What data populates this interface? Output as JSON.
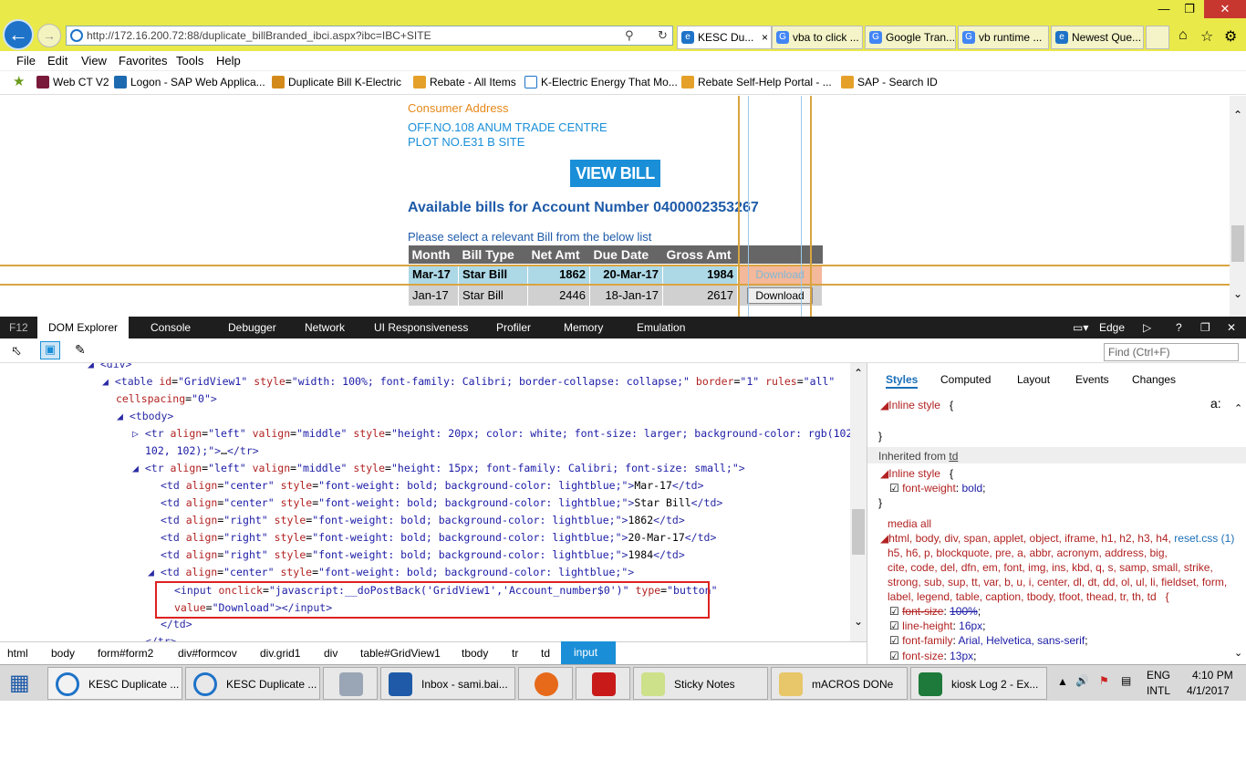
{
  "browser": {
    "address": "http://172.16.200.72:88/duplicate_billBranded_ibci.aspx?ibc=IBC+SITE",
    "tabs": [
      "KESC Du...",
      "vba to click ...",
      "Google Tran...",
      "vb runtime ...",
      "Newest Que..."
    ],
    "menu": [
      "File",
      "Edit",
      "View",
      "Favorites",
      "Tools",
      "Help"
    ],
    "favorites": [
      "Web CT V2",
      "Logon - SAP Web Applica...",
      "Duplicate Bill  K-Electric",
      "Rebate - All Items",
      "K-Electric Energy That Mo...",
      "Rebate Self-Help Portal - ...",
      "SAP - Search ID"
    ]
  },
  "page": {
    "consumer_label": "Consumer Address",
    "addr1": "OFF.NO.108 ANUM TRADE CENTRE",
    "addr2": "PLOT NO.E31 B SITE",
    "view_bill": "VIEW BILL",
    "available": "Available bills for Account Number 0400002353267",
    "please": "Please select a relevant Bill from the below list",
    "grid_headers": [
      "Month",
      "Bill Type",
      "Net Amt",
      "Due Date",
      "Gross Amt"
    ],
    "rows": [
      {
        "month": "Mar-17",
        "type": "Star Bill",
        "net": "1862",
        "due": "20-Mar-17",
        "gross": "1984",
        "btn": "Download"
      },
      {
        "month": "Jan-17",
        "type": "Star Bill",
        "net": "2446",
        "due": "18-Jan-17",
        "gross": "2617",
        "btn": "Download"
      }
    ]
  },
  "devtools": {
    "tabs": [
      "F12",
      "DOM Explorer",
      "Console",
      "Debugger",
      "Network",
      "UI Responsiveness",
      "Profiler",
      "Memory",
      "Emulation"
    ],
    "mode": "Edge",
    "find_placeholder": "Find (Ctrl+F)",
    "style_tabs": [
      "Styles",
      "Computed",
      "Layout",
      "Events",
      "Changes"
    ],
    "breadcrumb": [
      "html",
      "body",
      "form#form2",
      "div#formcov",
      "div.grid1",
      "div",
      "table#GridView1",
      "tbody",
      "tr",
      "td",
      "input"
    ]
  },
  "taskbar": {
    "items": [
      "KESC Duplicate ...",
      "KESC Duplicate ...",
      "Inbox - sami.bai...",
      "Sticky Notes",
      "mACROS DONe",
      "kiosk Log 2 - Ex..."
    ],
    "lang": "ENG",
    "layout": "INTL",
    "time": "4:10 PM",
    "date": "4/1/2017"
  }
}
